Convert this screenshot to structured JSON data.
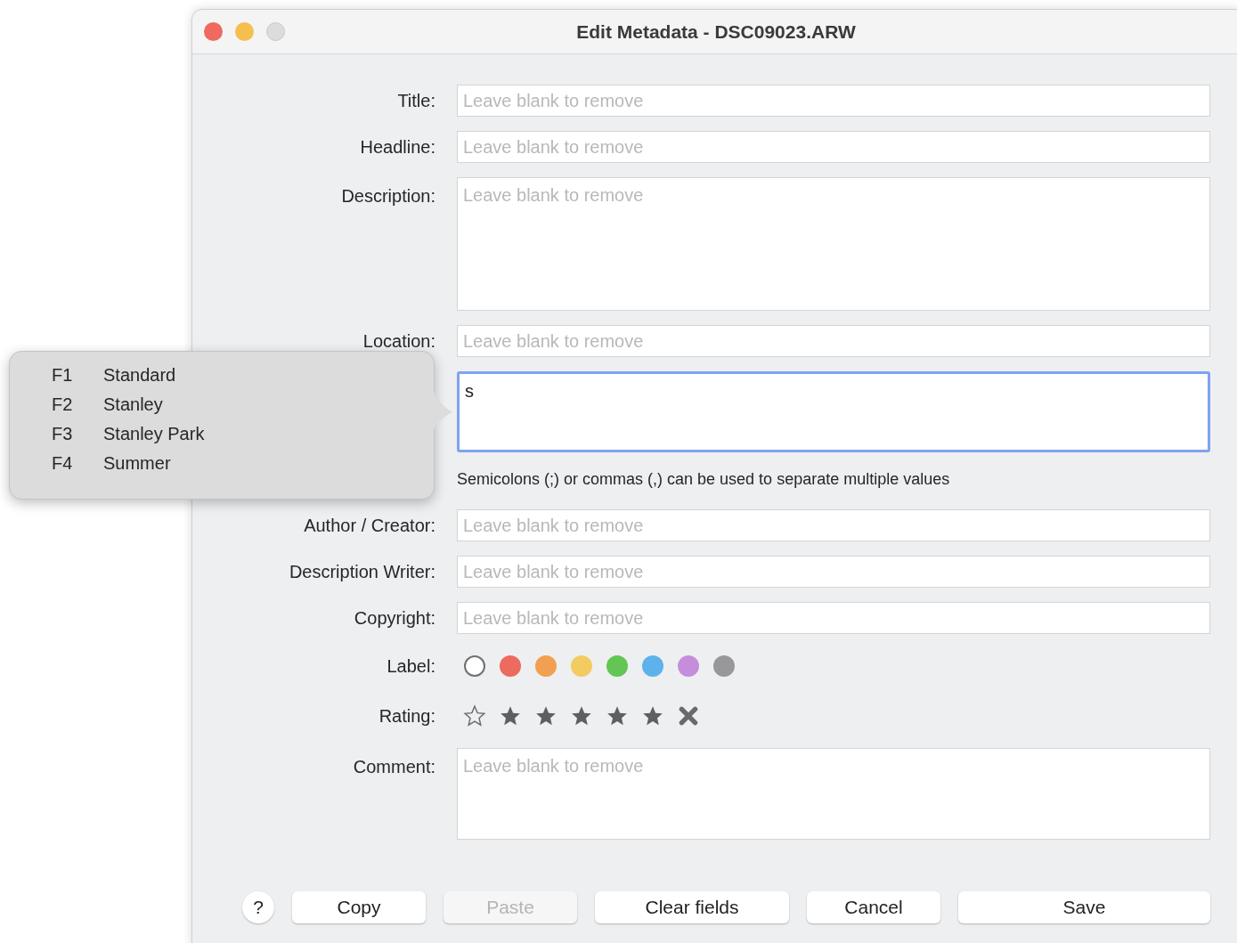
{
  "window": {
    "title": "Edit Metadata - DSC09023.ARW"
  },
  "rows": [
    {
      "kind": "line",
      "label": "Title:",
      "placeholder": "Leave blank to remove"
    },
    {
      "kind": "line",
      "label": "Headline:",
      "placeholder": "Leave blank to remove"
    },
    {
      "kind": "tall-area",
      "label": "Description:",
      "placeholder": "Leave blank to remove"
    },
    {
      "kind": "line",
      "label": "Location:",
      "placeholder": "Leave blank to remove"
    },
    {
      "kind": "area",
      "value": "s",
      "focused": true
    },
    {
      "kind": "hint",
      "text": "Semicolons (;) or commas (,) can be used to separate multiple values"
    },
    {
      "kind": "line",
      "label": "Author / Creator:",
      "placeholder": "Leave blank to remove"
    },
    {
      "kind": "line",
      "label": "Description Writer:",
      "placeholder": "Leave blank to remove"
    },
    {
      "kind": "line",
      "label": "Copyright:",
      "placeholder": "Leave blank to remove"
    },
    {
      "kind": "labels",
      "label": "Label:",
      "options": [
        {
          "kind": "none"
        },
        {
          "kind": "color",
          "color": "#ec6a5e"
        },
        {
          "kind": "color",
          "color": "#f0a050"
        },
        {
          "kind": "color",
          "color": "#f2cc60"
        },
        {
          "kind": "color",
          "color": "#62c554"
        },
        {
          "kind": "color",
          "color": "#5db2ec"
        },
        {
          "kind": "color",
          "color": "#c58ddc"
        },
        {
          "kind": "color",
          "color": "#98989b"
        }
      ]
    },
    {
      "kind": "rating",
      "label": "Rating:",
      "options": [
        {
          "kind": "no-rating"
        },
        {
          "kind": "star"
        },
        {
          "kind": "star"
        },
        {
          "kind": "star"
        },
        {
          "kind": "star"
        },
        {
          "kind": "star"
        },
        {
          "kind": "reject"
        }
      ]
    },
    {
      "kind": "area",
      "label": "Comment:",
      "placeholder": "Leave blank to remove",
      "focused": false
    }
  ],
  "buttons": [
    {
      "kind": "help",
      "label": "?",
      "disabled": false
    },
    {
      "kind": "normal",
      "label": "Copy",
      "disabled": false
    },
    {
      "kind": "normal",
      "label": "Paste",
      "disabled": true
    },
    {
      "kind": "wide",
      "label": "Clear fields",
      "disabled": false
    },
    {
      "kind": "normal",
      "label": "Cancel",
      "disabled": false
    },
    {
      "kind": "primary",
      "label": "Save",
      "disabled": false
    }
  ],
  "suggestions": [
    {
      "key": "F1",
      "text": "Standard"
    },
    {
      "key": "F2",
      "text": "Stanley"
    },
    {
      "key": "F3",
      "text": "Stanley Park"
    },
    {
      "key": "F4",
      "text": "Summer"
    }
  ]
}
